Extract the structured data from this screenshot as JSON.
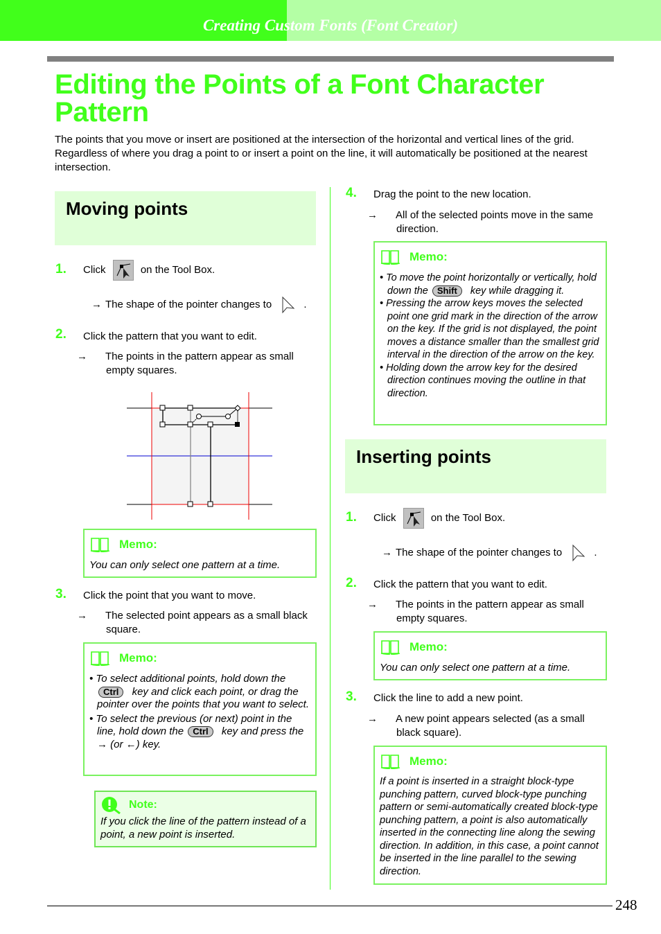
{
  "header": {
    "chapter_title": "Creating Custom Fonts (Font Creator)",
    "colors": {
      "dark_green": "#41ff1b",
      "light_green": "#b4ffa5",
      "rule_gray": "#808080"
    }
  },
  "page": {
    "title": "Editing the Points of a Font Character Pattern",
    "intro": "The points that you move or insert are positioned at the intersection of the horizontal and vertical lines of the grid. Regardless of where you drag a point to or insert a point on the line, it will automatically be positioned at the nearest intersection.",
    "page_number": "248"
  },
  "moving": {
    "heading": "Moving points",
    "steps": [
      {
        "num": "1.",
        "text_before": "Click",
        "icon": "point-edit-tool-icon",
        "text_after": "on the Tool Box.",
        "result_before": "The shape of the pointer changes to",
        "result_icon": "arrow-pointer-icon",
        "result_after": "."
      },
      {
        "num": "2.",
        "text": "Click the pattern that you want to edit.",
        "result": "The points in the pattern appear as small empty squares."
      },
      {
        "num": "3.",
        "text": "Click the point that you want to move.",
        "result": "The selected point appears as a small black square."
      },
      {
        "num": "4.",
        "text": "Drag the point to the new location.",
        "result": "All of the selected points move in the same direction."
      }
    ],
    "memo1": {
      "label": "Memo:",
      "icon": "book-icon",
      "text": "You can only select one pattern at a time."
    },
    "memo2": {
      "label": "Memo:",
      "icon": "book-icon",
      "b1_a": "To select additional points, hold down the",
      "b1_key": "Ctrl",
      "b1_b": "key and click each point, or drag the pointer over the points that you want to select.",
      "b2_a": "To select the previous (or next) point in the line, hold down the",
      "b2_key": "Ctrl",
      "b2_b": "key and press the → (or ←) key."
    },
    "note": {
      "label": "Note:",
      "icon": "exclamation-magnifier-icon",
      "text": "If you click the line of the pattern instead of a point, a new point is inserted."
    },
    "memo3": {
      "label": "Memo:",
      "icon": "book-icon",
      "b1_a": "To move the point horizontally or vertically, hold down the",
      "b1_key": "Shift",
      "b1_b": "key while dragging it.",
      "b2": "Pressing the arrow keys moves the selected point one grid mark in the direction of the arrow on the key. If the grid is not displayed, the point moves a distance smaller than the smallest grid interval in the direction of the arrow on the key.",
      "b3": "Holding down the arrow key for the desired direction continues moving the outline in that direction."
    }
  },
  "inserting": {
    "heading": "Inserting points",
    "steps": [
      {
        "num": "1.",
        "text_before": "Click",
        "icon": "point-edit-tool-icon",
        "text_after": "on the Tool Box.",
        "result_before": "The shape of the pointer changes to",
        "result_icon": "arrow-pointer-icon",
        "result_after": "."
      },
      {
        "num": "2.",
        "text": "Click the pattern that you want to edit.",
        "result": "The points in the pattern appear as small empty squares."
      },
      {
        "num": "3.",
        "text": "Click the line to add a new point.",
        "result": "A new point appears selected (as a small black square)."
      }
    ],
    "memo1": {
      "label": "Memo:",
      "icon": "book-icon",
      "text": "You can only select one pattern at a time."
    },
    "memo2": {
      "label": "Memo:",
      "icon": "book-icon",
      "text": "If a point is inserted in a straight block-type punching pattern, curved block-type punching pattern or semi-automatically created block-type punching pattern, a point is also automatically inserted in the connecting line along the sewing direction. In addition, in this case, a point cannot be inserted in the line parallel to the sewing direction."
    }
  },
  "arrow_symbol": "→"
}
